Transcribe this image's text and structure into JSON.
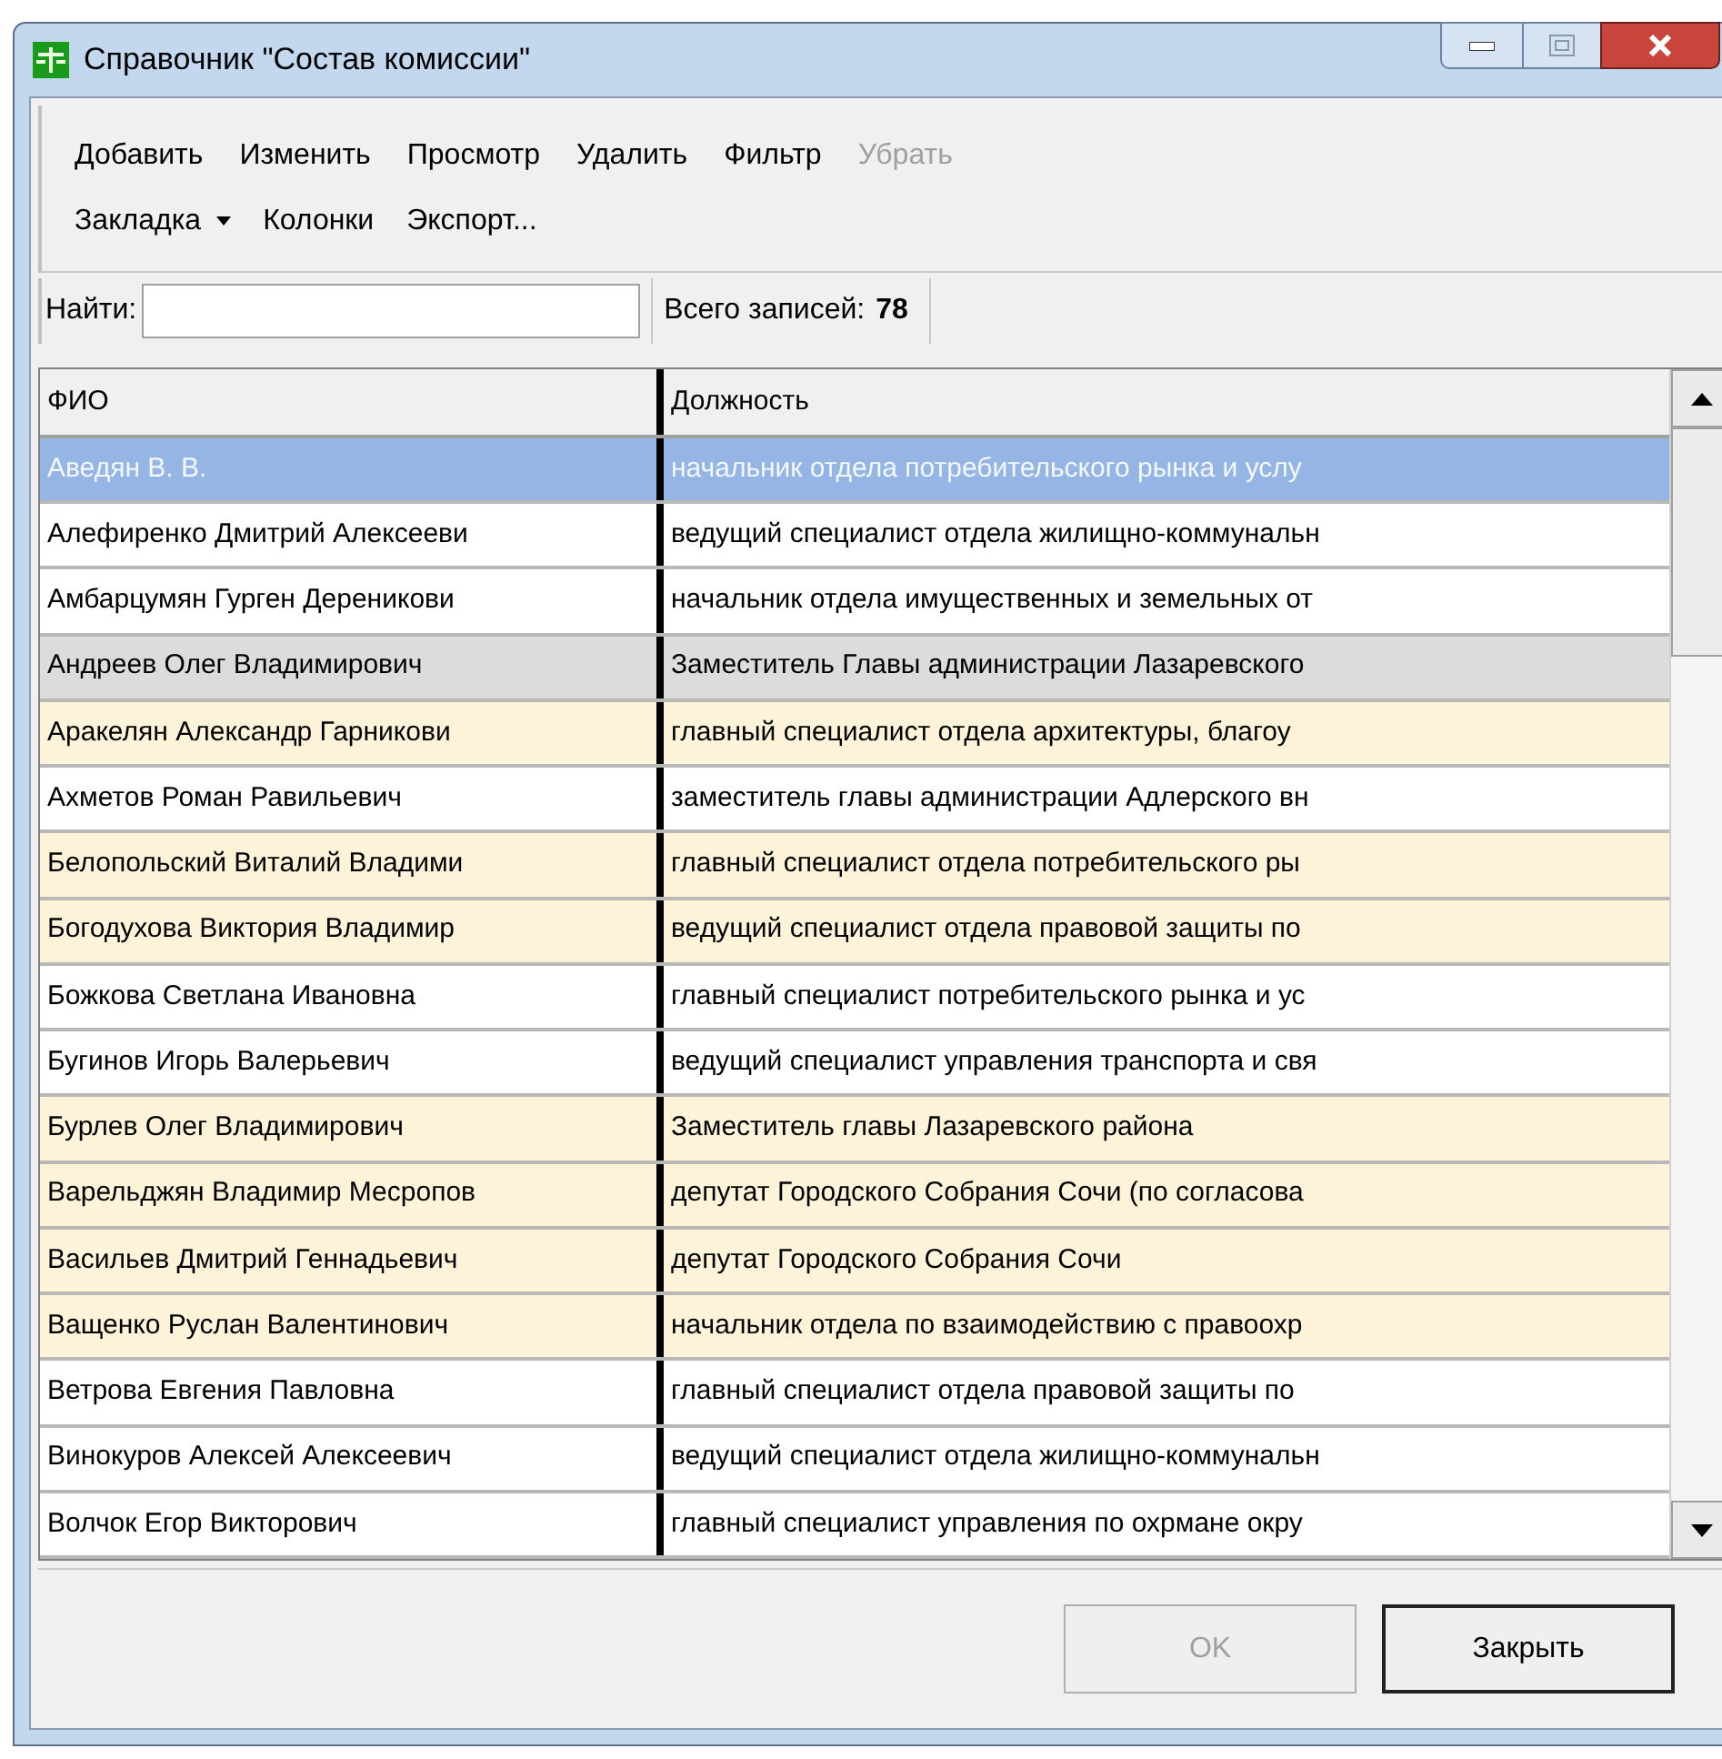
{
  "window": {
    "title": "Справочник \"Состав комиссии\""
  },
  "toolbar": {
    "rows": [
      [
        {
          "kind": "button",
          "label": "Добавить",
          "disabled": false
        },
        {
          "kind": "button",
          "label": "Изменить",
          "disabled": false
        },
        {
          "kind": "button",
          "label": "Просмотр",
          "disabled": false
        },
        {
          "kind": "button",
          "label": "Удалить",
          "disabled": false
        },
        {
          "kind": "button",
          "label": "Фильтр",
          "disabled": false
        },
        {
          "kind": "button",
          "label": "Убрать",
          "disabled": true
        }
      ],
      [
        {
          "kind": "dropdown",
          "label": "Закладка",
          "disabled": false
        },
        {
          "kind": "button",
          "label": "Колонки",
          "disabled": false
        },
        {
          "kind": "button",
          "label": "Экспорт...",
          "disabled": false
        }
      ]
    ]
  },
  "search": {
    "label": "Найти:",
    "total_label": "Всего записей:",
    "total": "78"
  },
  "table": {
    "columns": [
      "ФИО",
      "Должность"
    ],
    "rows": [
      {
        "cells": [
          "Аведян В. В.",
          "начальник отдела потребительского рынка и услу"
        ],
        "selected": true,
        "color": "#95b5e5"
      },
      {
        "cells": [
          "Алефиренко Дмитрий Алексееви",
          "ведущий специалист отдела жилищно-коммунальн"
        ],
        "selected": false,
        "color": "#ffffff"
      },
      {
        "cells": [
          "Амбарцумян Гурген Дереникови",
          "начальник отдела имущественных и земельных от"
        ],
        "selected": false,
        "color": "#ffffff"
      },
      {
        "cells": [
          "Андреев Олег Владимирович",
          "Заместитель Главы администрации Лазаревского"
        ],
        "selected": false,
        "color": "#dcdcdc"
      },
      {
        "cells": [
          "Аракелян Александр Гарникови",
          "главный специалист отдела архитектуры, благоу"
        ],
        "selected": false,
        "color": "#fdf3d9"
      },
      {
        "cells": [
          "Ахметов Роман Равильевич",
          "заместитель главы администрации Адлерского вн"
        ],
        "selected": false,
        "color": "#ffffff"
      },
      {
        "cells": [
          "Белопольский Виталий Владими",
          "главный специалист отдела потребительского ры"
        ],
        "selected": false,
        "color": "#fdf3d9"
      },
      {
        "cells": [
          "Богодухова Виктория Владимир",
          "ведущий специалист отдела правовой защиты по"
        ],
        "selected": false,
        "color": "#fdf3d9"
      },
      {
        "cells": [
          "Божкова Светлана Ивановна",
          "главный специалист потребительского рынка и ус"
        ],
        "selected": false,
        "color": "#ffffff"
      },
      {
        "cells": [
          "Бугинов Игорь Валерьевич",
          "ведущий специалист управления транспорта и свя"
        ],
        "selected": false,
        "color": "#ffffff"
      },
      {
        "cells": [
          "Бурлев Олег Владимирович",
          "Заместитель главы Лазаревского района"
        ],
        "selected": false,
        "color": "#fdf3d9"
      },
      {
        "cells": [
          "Варельджян Владимир Месропов",
          "депутат Городского Собрания Сочи (по согласова"
        ],
        "selected": false,
        "color": "#fdf3d9"
      },
      {
        "cells": [
          "Васильев Дмитрий Геннадьевич",
          "депутат Городского Собрания Сочи"
        ],
        "selected": false,
        "color": "#fdf3d9"
      },
      {
        "cells": [
          "Ващенко Руслан Валентинович",
          "начальник отдела по взаимодействию с правоохр"
        ],
        "selected": false,
        "color": "#fdf3d9"
      },
      {
        "cells": [
          "Ветрова Евгения Павловна",
          "главный специалист отдела правовой защиты по"
        ],
        "selected": false,
        "color": "#ffffff"
      },
      {
        "cells": [
          "Винокуров Алексей Алексеевич",
          "ведущий специалист отдела жилищно-коммунальн"
        ],
        "selected": false,
        "color": "#ffffff"
      },
      {
        "cells": [
          "Волчок Егор Викторович",
          "главный специалист управления по охрмане окру"
        ],
        "selected": false,
        "color": "#ffffff"
      }
    ]
  },
  "buttons": [
    {
      "label": "OK",
      "disabled": true,
      "default": false
    },
    {
      "label": "Закрыть",
      "disabled": false,
      "default": true
    }
  ]
}
